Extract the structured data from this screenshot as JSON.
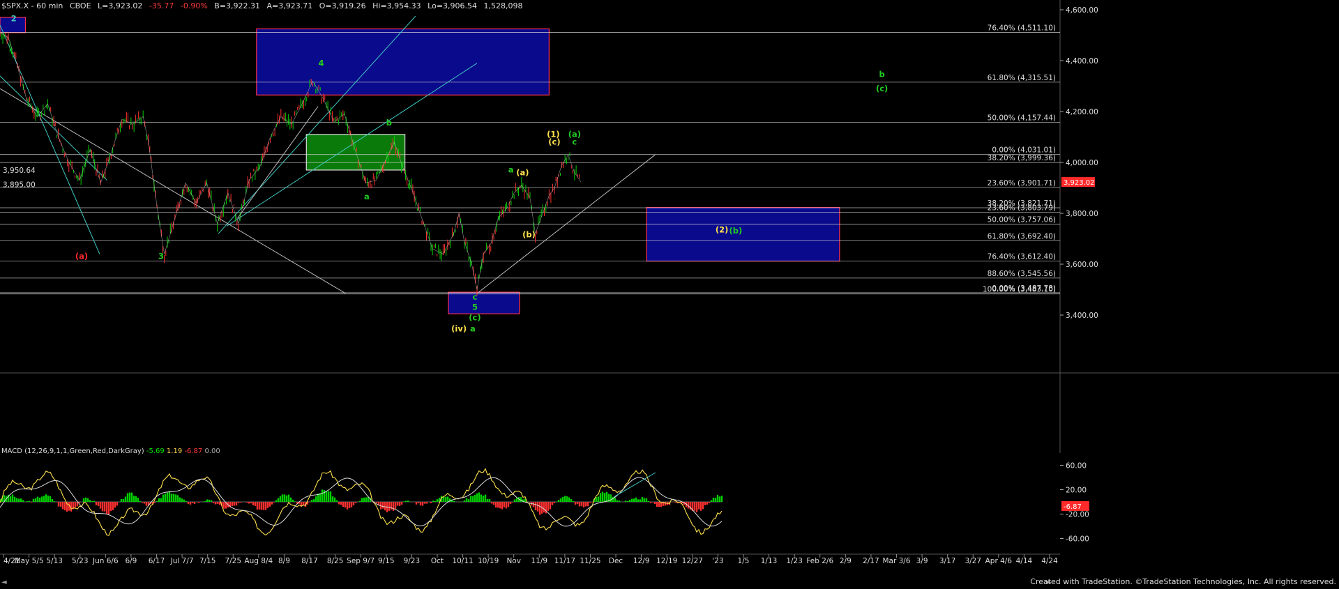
{
  "header": {
    "symbol": "$SPX.X - 60 min",
    "exchange": "CBOE",
    "last": "L=3,923.02",
    "change": "-35.77",
    "change_pct": "-0.90%",
    "bid": "B=3,922.31",
    "ask": "A=3,923.71",
    "open": "O=3,919.26",
    "high": "Hi=3,954.33",
    "low": "Lo=3,906.54",
    "volume": "1,528,098"
  },
  "macd_header": {
    "label": "MACD (12,26,9,1,1,Green,Red,DarkGray)",
    "v1": "-5.69",
    "v2": "1.19",
    "v3": "-6.87",
    "v4": "0.00"
  },
  "footer": "Created with TradeStation. ©TradeStation Technologies, Inc. All rights reserved.",
  "scroll_left": "◄",
  "scroll_right": "►",
  "colors": {
    "bg": "#000000",
    "price_up": "#00d000",
    "price_down": "#ff3030",
    "fib_line": "#d8d8d8",
    "trend_cyan": "#3fc8c0",
    "box_blue": "#0a0a8c",
    "box_border": "#ff3050",
    "box_green": "#0a7a0a",
    "label_green": "#22cc22",
    "label_yellow": "#ffe14d",
    "label_red": "#ff2a2a",
    "last_price_bg": "#ff2a2a"
  },
  "chart_data": {
    "type": "line",
    "title": "$SPX.X - 60 min",
    "price_axis": {
      "ylim": [
        3200,
        4600
      ],
      "ticks": [
        "4,600.00",
        "4,400.00",
        "4,200.00",
        "4,000.00",
        "3,800.00",
        "3,600.00",
        "3,400.00"
      ],
      "tick_values": [
        4600,
        4400,
        4200,
        4000,
        3800,
        3600,
        3400
      ],
      "last_price_label": "3,923.02",
      "last_price": 3923.02
    },
    "x_axis_labels": [
      "4/21",
      "May 5/5",
      "5/13",
      "5/23",
      "Jun 6/6",
      "6/9",
      "6/17",
      "Jul 7/7",
      "7/15",
      "7/25",
      "Aug 8/4",
      "8/9",
      "8/17",
      "8/25",
      "Sep 9/7",
      "9/15",
      "9/23",
      "Oct",
      "10/11",
      "10/19",
      "Nov",
      "11/9",
      "11/17",
      "11/25",
      "Dec",
      "12/9",
      "12/19",
      "12/27",
      "'23",
      "1/5",
      "1/13",
      "1/23",
      "Feb 2/6",
      "2/9",
      "2/17",
      "Mar 3/6",
      "3/9",
      "3/17",
      "3/27",
      "Apr 4/6",
      "4/14",
      "4/24"
    ],
    "price_path": [
      [
        0,
        4510
      ],
      [
        0.008,
        4490
      ],
      [
        0.015,
        4400
      ],
      [
        0.025,
        4250
      ],
      [
        0.035,
        4180
      ],
      [
        0.045,
        4230
      ],
      [
        0.055,
        4100
      ],
      [
        0.065,
        4000
      ],
      [
        0.075,
        3930
      ],
      [
        0.085,
        4050
      ],
      [
        0.095,
        3920
      ],
      [
        0.102,
        4000
      ],
      [
        0.115,
        4170
      ],
      [
        0.125,
        4150
      ],
      [
        0.135,
        4180
      ],
      [
        0.14,
        4080
      ],
      [
        0.148,
        3830
      ],
      [
        0.155,
        3640
      ],
      [
        0.165,
        3780
      ],
      [
        0.175,
        3920
      ],
      [
        0.185,
        3840
      ],
      [
        0.195,
        3920
      ],
      [
        0.205,
        3760
      ],
      [
        0.215,
        3880
      ],
      [
        0.225,
        3760
      ],
      [
        0.235,
        3930
      ],
      [
        0.245,
        3980
      ],
      [
        0.255,
        4100
      ],
      [
        0.265,
        4180
      ],
      [
        0.275,
        4150
      ],
      [
        0.285,
        4230
      ],
      [
        0.295,
        4320
      ],
      [
        0.305,
        4250
      ],
      [
        0.315,
        4160
      ],
      [
        0.325,
        4190
      ],
      [
        0.335,
        4050
      ],
      [
        0.345,
        3920
      ],
      [
        0.355,
        3930
      ],
      [
        0.365,
        4020
      ],
      [
        0.372,
        4080
      ],
      [
        0.38,
        3980
      ],
      [
        0.388,
        3900
      ],
      [
        0.398,
        3780
      ],
      [
        0.408,
        3660
      ],
      [
        0.418,
        3640
      ],
      [
        0.428,
        3720
      ],
      [
        0.433,
        3800
      ],
      [
        0.438,
        3690
      ],
      [
        0.445,
        3600
      ],
      [
        0.45,
        3500
      ],
      [
        0.456,
        3640
      ],
      [
        0.463,
        3680
      ],
      [
        0.47,
        3780
      ],
      [
        0.478,
        3820
      ],
      [
        0.485,
        3880
      ],
      [
        0.492,
        3910
      ],
      [
        0.5,
        3860
      ],
      [
        0.505,
        3720
      ],
      [
        0.512,
        3800
      ],
      [
        0.518,
        3870
      ],
      [
        0.523,
        3900
      ],
      [
        0.53,
        3990
      ],
      [
        0.536,
        4030
      ],
      [
        0.542,
        3960
      ],
      [
        0.548,
        3923
      ]
    ],
    "fib_levels": [
      {
        "label": "76.40% (4,511.10)",
        "value": 4511.1
      },
      {
        "label": "61.80% (4,315.51)",
        "value": 4315.51
      },
      {
        "label": "50.00% (4,157.44)",
        "value": 4157.44
      },
      {
        "label": "0.00% (4,031.01)",
        "value": 4031.01
      },
      {
        "label": "38.20% (3,999.36)",
        "value": 3999.36
      },
      {
        "label": "23.60% (3,901.71)",
        "value": 3901.71
      },
      {
        "label": "38.20% (3,821.71)",
        "value": 3821.71
      },
      {
        "label": "23.60% (3,803.79)",
        "value": 3803.79
      },
      {
        "label": "50.00% (3,757.06)",
        "value": 3757.06
      },
      {
        "label": "61.80% (3,692.40)",
        "value": 3692.4
      },
      {
        "label": "76.40% (3,612.40)",
        "value": 3612.4
      },
      {
        "label": "88.60% (3,545.56)",
        "value": 3545.56
      },
      {
        "label": "0.00% (3,487.78)",
        "value": 3487.78
      },
      {
        "label": "100.00% (3,483.10)",
        "value": 3483.1
      }
    ],
    "left_levels": [
      {
        "label": "3,950.64",
        "value": 3950.64
      },
      {
        "label": "3,895.00",
        "value": 3895.0
      }
    ],
    "wave_labels": [
      {
        "text": "2",
        "t": 0.013,
        "p": 4555,
        "color": "cyan"
      },
      {
        "text": "(a)",
        "t": 0.077,
        "p": 3620,
        "color": "red"
      },
      {
        "text": "3",
        "t": 0.152,
        "p": 3620,
        "color": "green"
      },
      {
        "text": "4",
        "t": 0.303,
        "p": 4380,
        "color": "green"
      },
      {
        "text": "b",
        "t": 0.367,
        "p": 4145,
        "color": "green"
      },
      {
        "text": "a",
        "t": 0.346,
        "p": 3855,
        "color": "green"
      },
      {
        "text": "c",
        "t": 0.448,
        "p": 3460,
        "color": "green"
      },
      {
        "text": "5",
        "t": 0.448,
        "p": 3420,
        "color": "green"
      },
      {
        "text": "(c)",
        "t": 0.448,
        "p": 3380,
        "color": "green"
      },
      {
        "text": "(iv)",
        "t": 0.433,
        "p": 3335,
        "color": "yellow"
      },
      {
        "text": "a",
        "t": 0.446,
        "p": 3335,
        "color": "green"
      },
      {
        "text": "a",
        "t": 0.482,
        "p": 3960,
        "color": "green"
      },
      {
        "text": "(a)",
        "t": 0.493,
        "p": 3950,
        "color": "yellow"
      },
      {
        "text": "(b)",
        "t": 0.499,
        "p": 3705,
        "color": "yellow"
      },
      {
        "text": "(1)",
        "t": 0.522,
        "p": 4100,
        "color": "yellow"
      },
      {
        "text": "(c)",
        "t": 0.523,
        "p": 4070,
        "color": "yellow"
      },
      {
        "text": "(a)",
        "t": 0.542,
        "p": 4100,
        "color": "green"
      },
      {
        "text": "c",
        "t": 0.542,
        "p": 4070,
        "color": "green"
      },
      {
        "text": "(2)",
        "t": 0.681,
        "p": 3725,
        "color": "yellow"
      },
      {
        "text": "(b)",
        "t": 0.694,
        "p": 3720,
        "color": "green"
      },
      {
        "text": "b",
        "t": 0.832,
        "p": 4335,
        "color": "green"
      },
      {
        "text": "(c)",
        "t": 0.832,
        "p": 4280,
        "color": "green"
      }
    ],
    "boxes": [
      {
        "kind": "blue",
        "t0": 0.0,
        "t1": 0.024,
        "p0": 4510,
        "p1": 4570
      },
      {
        "kind": "blue",
        "t0": 0.242,
        "t1": 0.518,
        "p0": 4265,
        "p1": 4525
      },
      {
        "kind": "green",
        "t0": 0.289,
        "t1": 0.382,
        "p0": 3970,
        "p1": 4110
      },
      {
        "kind": "blue",
        "t0": 0.423,
        "t1": 0.49,
        "p0": 3405,
        "p1": 3490
      },
      {
        "kind": "blue",
        "t0": 0.61,
        "t1": 0.792,
        "p0": 3612,
        "p1": 3823
      }
    ],
    "trend_lines": [
      {
        "color": "cyan",
        "t0": 0.0,
        "p0": 4540,
        "t1": 0.094,
        "p1": 3640
      },
      {
        "color": "cyan",
        "t0": 0.0,
        "p0": 4340,
        "t1": 0.101,
        "p1": 3930
      },
      {
        "color": "cyan",
        "t0": 0.206,
        "p0": 3720,
        "t1": 0.392,
        "p1": 4575
      },
      {
        "color": "cyan",
        "t0": 0.214,
        "p0": 3750,
        "t1": 0.45,
        "p1": 4390
      },
      {
        "color": "gray",
        "t0": 0.0,
        "p0": 4290,
        "t1": 0.326,
        "p1": 3485
      },
      {
        "color": "gray",
        "t0": 0.45,
        "p0": 3485,
        "t1": 0.618,
        "p1": 4030
      },
      {
        "color": "gray",
        "t0": 0.224,
        "p0": 3780,
        "t1": 0.3,
        "p1": 4220
      }
    ],
    "macd": {
      "ylim": [
        -80,
        80
      ],
      "ticks": [
        "60.00",
        "20.00",
        "-20.00",
        "-60.00"
      ],
      "tick_values": [
        60,
        20,
        -20,
        -60
      ],
      "current_label": "-6.87",
      "current": -6.87
    }
  }
}
